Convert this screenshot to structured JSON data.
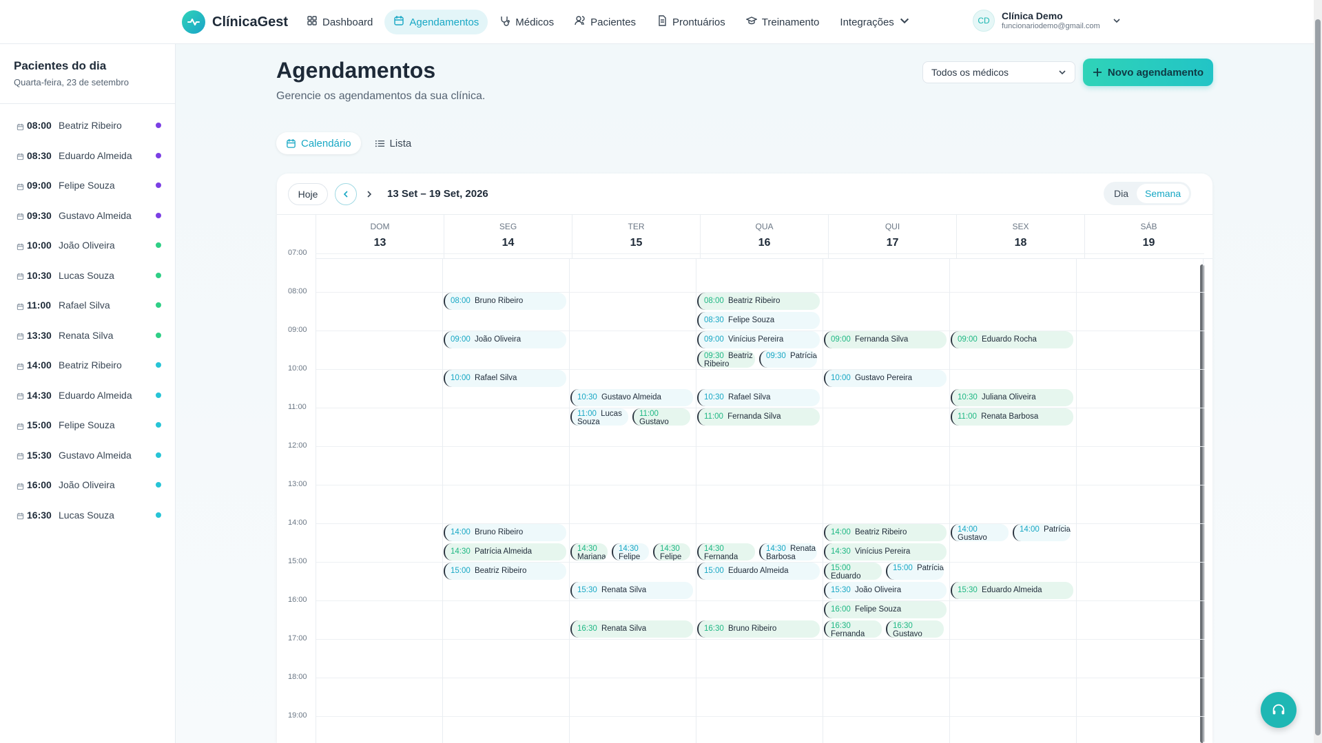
{
  "brand": {
    "name": "ClínicaGest"
  },
  "nav": [
    {
      "label": "Dashboard",
      "icon": "dashboard-icon",
      "active": false
    },
    {
      "label": "Agendamentos",
      "icon": "calendar-icon",
      "active": true
    },
    {
      "label": "Médicos",
      "icon": "stethoscope-icon",
      "active": false
    },
    {
      "label": "Pacientes",
      "icon": "users-icon",
      "active": false
    },
    {
      "label": "Prontuários",
      "icon": "file-icon",
      "active": false
    },
    {
      "label": "Treinamento",
      "icon": "graduation-icon",
      "active": false
    },
    {
      "label": "Integrações",
      "icon": "chevron-down-icon",
      "active": false
    }
  ],
  "user": {
    "initials": "CD",
    "name": "Clínica Demo",
    "email": "funcionariodemo@gmail.com"
  },
  "sidebar": {
    "title": "Pacientes do dia",
    "date": "Quarta-feira, 23 de setembro",
    "items": [
      {
        "time": "08:00",
        "name": "Beatriz Ribeiro",
        "color": "#7b3fe4"
      },
      {
        "time": "08:30",
        "name": "Eduardo Almeida",
        "color": "#7b3fe4"
      },
      {
        "time": "09:00",
        "name": "Felipe Souza",
        "color": "#7b3fe4"
      },
      {
        "time": "09:30",
        "name": "Gustavo Almeida",
        "color": "#7b3fe4"
      },
      {
        "time": "10:00",
        "name": "João Oliveira",
        "color": "#2fcf86"
      },
      {
        "time": "10:30",
        "name": "Lucas Souza",
        "color": "#2fcf86"
      },
      {
        "time": "11:00",
        "name": "Rafael Silva",
        "color": "#2fcf86"
      },
      {
        "time": "13:30",
        "name": "Renata Silva",
        "color": "#2fcf86"
      },
      {
        "time": "14:00",
        "name": "Beatriz Ribeiro",
        "color": "#27c4d6"
      },
      {
        "time": "14:30",
        "name": "Eduardo Almeida",
        "color": "#27c4d6"
      },
      {
        "time": "15:00",
        "name": "Felipe Souza",
        "color": "#27c4d6"
      },
      {
        "time": "15:30",
        "name": "Gustavo Almeida",
        "color": "#27c4d6"
      },
      {
        "time": "16:00",
        "name": "João Oliveira",
        "color": "#27c4d6"
      },
      {
        "time": "16:30",
        "name": "Lucas Souza",
        "color": "#27c4d6"
      }
    ]
  },
  "page": {
    "title": "Agendamentos",
    "subtitle": "Gerencie os agendamentos da sua clínica."
  },
  "doctor_filter": {
    "selected": "Todos os médicos"
  },
  "new_button": {
    "label": "Novo agendamento"
  },
  "view_toggle": {
    "calendar": "Calendário",
    "list": "Lista"
  },
  "calendar": {
    "today_label": "Hoje",
    "range": "13 Set – 19 Set, 2026",
    "modes": {
      "day": "Dia",
      "week": "Semana",
      "active": "Semana"
    },
    "days": [
      {
        "name": "DOM",
        "num": "13"
      },
      {
        "name": "SEG",
        "num": "14"
      },
      {
        "name": "TER",
        "num": "15"
      },
      {
        "name": "QUA",
        "num": "16"
      },
      {
        "name": "QUI",
        "num": "17"
      },
      {
        "name": "SEX",
        "num": "18"
      },
      {
        "name": "SÁB",
        "num": "19"
      }
    ],
    "hours": [
      "07:00",
      "08:00",
      "09:00",
      "10:00",
      "11:00",
      "12:00",
      "13:00",
      "14:00",
      "15:00",
      "16:00",
      "17:00",
      "18:00",
      "19:00"
    ],
    "appointments": [
      {
        "day": 1,
        "time": "08:00",
        "name": "Bruno Ribeiro",
        "color": "b",
        "slot": 0,
        "of": 1
      },
      {
        "day": 1,
        "time": "09:00",
        "name": "João Oliveira",
        "color": "b",
        "slot": 0,
        "of": 1
      },
      {
        "day": 1,
        "time": "10:00",
        "name": "Rafael Silva",
        "color": "b",
        "slot": 0,
        "of": 1
      },
      {
        "day": 1,
        "time": "14:00",
        "name": "Bruno Ribeiro",
        "color": "b",
        "slot": 0,
        "of": 1
      },
      {
        "day": 1,
        "time": "14:30",
        "name": "Patrícia Almeida",
        "color": "g",
        "slot": 0,
        "of": 1
      },
      {
        "day": 1,
        "time": "15:00",
        "name": "Beatriz Ribeiro",
        "color": "b",
        "slot": 0,
        "of": 1
      },
      {
        "day": 2,
        "time": "10:30",
        "name": "Gustavo Almeida",
        "color": "b",
        "slot": 0,
        "of": 1
      },
      {
        "day": 2,
        "time": "11:00",
        "name": "Lucas Souza",
        "color": "b",
        "slot": 0,
        "of": 2
      },
      {
        "day": 2,
        "time": "11:00",
        "name": "Gustavo",
        "color": "g",
        "slot": 1,
        "of": 2
      },
      {
        "day": 2,
        "time": "14:30",
        "name": "Mariana",
        "color": "g",
        "slot": 0,
        "of": 3
      },
      {
        "day": 2,
        "time": "14:30",
        "name": "Felipe",
        "color": "b",
        "slot": 1,
        "of": 3
      },
      {
        "day": 2,
        "time": "14:30",
        "name": "Felipe",
        "color": "g",
        "slot": 2,
        "of": 3
      },
      {
        "day": 2,
        "time": "15:30",
        "name": "Renata Silva",
        "color": "b",
        "slot": 0,
        "of": 1
      },
      {
        "day": 2,
        "time": "16:30",
        "name": "Renata Silva",
        "color": "g",
        "slot": 0,
        "of": 1
      },
      {
        "day": 3,
        "time": "08:00",
        "name": "Beatriz Ribeiro",
        "color": "g",
        "slot": 0,
        "of": 1
      },
      {
        "day": 3,
        "time": "08:30",
        "name": "Felipe Souza",
        "color": "b",
        "slot": 0,
        "of": 1
      },
      {
        "day": 3,
        "time": "09:00",
        "name": "Vinícius Pereira",
        "color": "b",
        "slot": 0,
        "of": 1
      },
      {
        "day": 3,
        "time": "09:30",
        "name": "Beatriz Ribeiro",
        "color": "g",
        "slot": 0,
        "of": 2
      },
      {
        "day": 3,
        "time": "09:30",
        "name": "Patrícia",
        "color": "b",
        "slot": 1,
        "of": 2
      },
      {
        "day": 3,
        "time": "10:30",
        "name": "Rafael Silva",
        "color": "b",
        "slot": 0,
        "of": 1
      },
      {
        "day": 3,
        "time": "11:00",
        "name": "Fernanda Silva",
        "color": "g",
        "slot": 0,
        "of": 1
      },
      {
        "day": 3,
        "time": "14:30",
        "name": "Fernanda",
        "color": "g",
        "slot": 0,
        "of": 2
      },
      {
        "day": 3,
        "time": "14:30",
        "name": "Renata Barbosa",
        "color": "b",
        "slot": 1,
        "of": 2
      },
      {
        "day": 3,
        "time": "15:00",
        "name": "Eduardo Almeida",
        "color": "b",
        "slot": 0,
        "of": 1
      },
      {
        "day": 3,
        "time": "16:30",
        "name": "Bruno Ribeiro",
        "color": "g",
        "slot": 0,
        "of": 1
      },
      {
        "day": 4,
        "time": "09:00",
        "name": "Fernanda Silva",
        "color": "g",
        "slot": 0,
        "of": 1
      },
      {
        "day": 4,
        "time": "10:00",
        "name": "Gustavo Pereira",
        "color": "b",
        "slot": 0,
        "of": 1
      },
      {
        "day": 4,
        "time": "14:00",
        "name": "Beatriz Ribeiro",
        "color": "g",
        "slot": 0,
        "of": 1
      },
      {
        "day": 4,
        "time": "14:30",
        "name": "Vinícius Pereira",
        "color": "g",
        "slot": 0,
        "of": 1
      },
      {
        "day": 4,
        "time": "15:00",
        "name": "Eduardo",
        "color": "g",
        "slot": 0,
        "of": 2
      },
      {
        "day": 4,
        "time": "15:00",
        "name": "Patrícia",
        "color": "b",
        "slot": 1,
        "of": 2
      },
      {
        "day": 4,
        "time": "15:30",
        "name": "João Oliveira",
        "color": "b",
        "slot": 0,
        "of": 1
      },
      {
        "day": 4,
        "time": "16:00",
        "name": "Felipe Souza",
        "color": "g",
        "slot": 0,
        "of": 1
      },
      {
        "day": 4,
        "time": "16:30",
        "name": "Fernanda",
        "color": "g",
        "slot": 0,
        "of": 2
      },
      {
        "day": 4,
        "time": "16:30",
        "name": "Gustavo",
        "color": "g",
        "slot": 1,
        "of": 2
      },
      {
        "day": 5,
        "time": "09:00",
        "name": "Eduardo Rocha",
        "color": "g",
        "slot": 0,
        "of": 1
      },
      {
        "day": 5,
        "time": "10:30",
        "name": "Juliana Oliveira",
        "color": "g",
        "slot": 0,
        "of": 1
      },
      {
        "day": 5,
        "time": "11:00",
        "name": "Renata Barbosa",
        "color": "g",
        "slot": 0,
        "of": 1
      },
      {
        "day": 5,
        "time": "14:00",
        "name": "Gustavo",
        "color": "b",
        "slot": 0,
        "of": 2
      },
      {
        "day": 5,
        "time": "14:00",
        "name": "Patrícia",
        "color": "b",
        "slot": 1,
        "of": 2
      },
      {
        "day": 5,
        "time": "15:30",
        "name": "Eduardo Almeida",
        "color": "g",
        "slot": 0,
        "of": 1
      }
    ]
  }
}
